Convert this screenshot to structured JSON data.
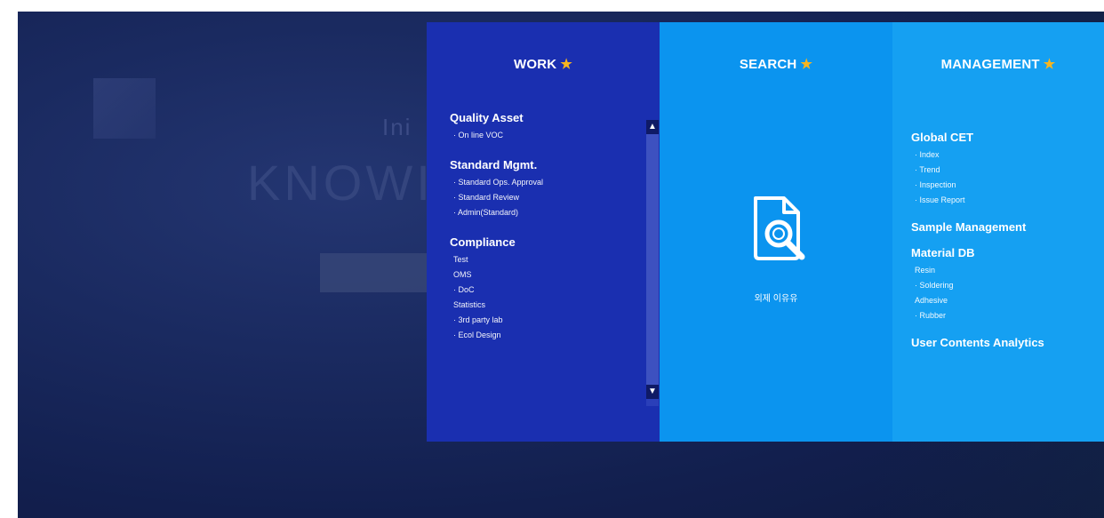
{
  "background": {
    "hero_small": "Ini",
    "hero_big": "KNOWI"
  },
  "menu": {
    "work": {
      "title": "WORK",
      "groups": [
        {
          "title": "Quality Asset",
          "items": [
            "On line VOC"
          ]
        },
        {
          "title": "Standard Mgmt.",
          "items": [
            "Standard Ops. Approval",
            "Standard Review",
            "Admin(Standard)"
          ]
        },
        {
          "title": "Compliance",
          "items": [
            "Test",
            "OMS",
            "DoC",
            "Statistics",
            "3rd party lab",
            "Ecol Design"
          ]
        }
      ]
    },
    "search": {
      "title": "SEARCH",
      "label": "외제 이유유"
    },
    "management": {
      "title": "MANAGEMENT",
      "groups": [
        {
          "title": "Global CET",
          "items": [
            "Index",
            "Trend",
            "Inspection",
            "Issue Report"
          ]
        },
        {
          "title": "Sample Management",
          "items": []
        },
        {
          "title": "Material DB",
          "items": [
            "Resin",
            "Soldering",
            "Adhesive",
            "Rubber"
          ]
        },
        {
          "title": "User Contents Analytics",
          "items": []
        }
      ]
    }
  },
  "colors": {
    "work_bg": "#1a2fb0",
    "search_bg": "#0b94ef",
    "management_bg": "#15a0f2",
    "star": "#f6b520"
  },
  "icons": {
    "star": "star-icon",
    "search_document": "document-search-icon",
    "scroll_up": "chevron-up-icon",
    "scroll_down": "chevron-down-icon"
  }
}
